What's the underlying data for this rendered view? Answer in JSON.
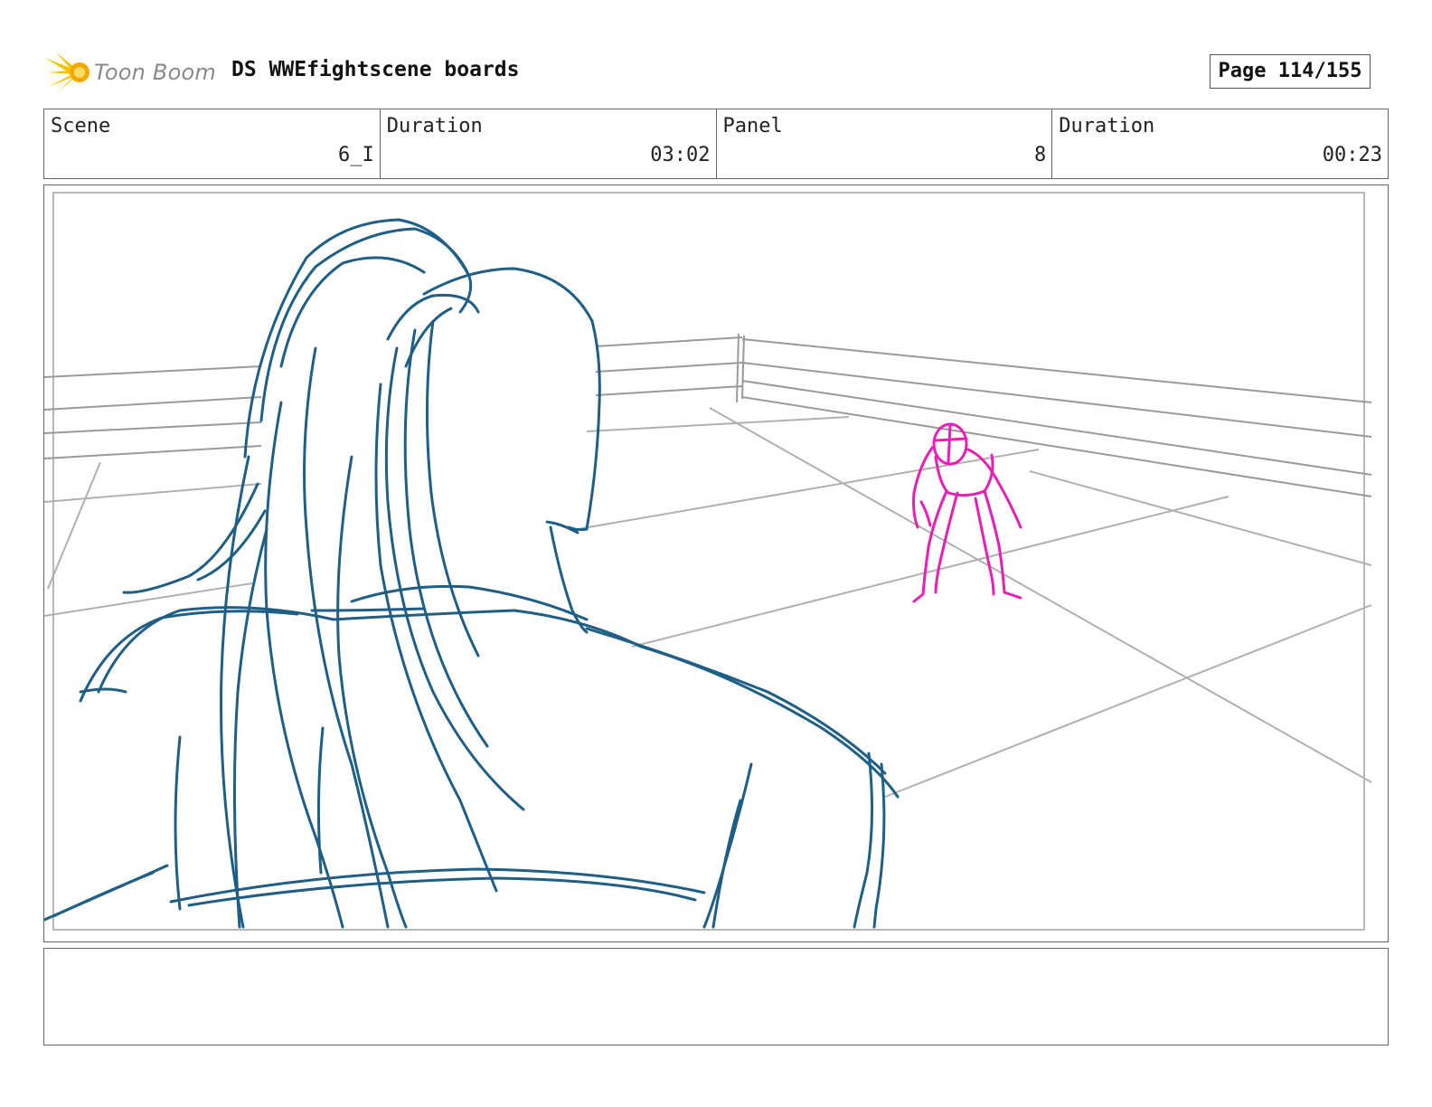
{
  "header": {
    "logo_text": "Toon Boom",
    "title": "DS WWEfightscene boards",
    "page_label": "Page 114/155"
  },
  "info": {
    "scene": {
      "label": "Scene",
      "value": "6_I"
    },
    "scene_duration": {
      "label": "Duration",
      "value": "03:02"
    },
    "panel": {
      "label": "Panel",
      "value": "8"
    },
    "panel_duration": {
      "label": "Duration",
      "value": "00:23"
    }
  },
  "colors": {
    "foreground_sketch": "#1f5f86",
    "background_figure": "#e81fb4",
    "ring_lines": "#9a9a9a",
    "logo_burst": "#f5c400"
  },
  "notes": {
    "text": ""
  }
}
